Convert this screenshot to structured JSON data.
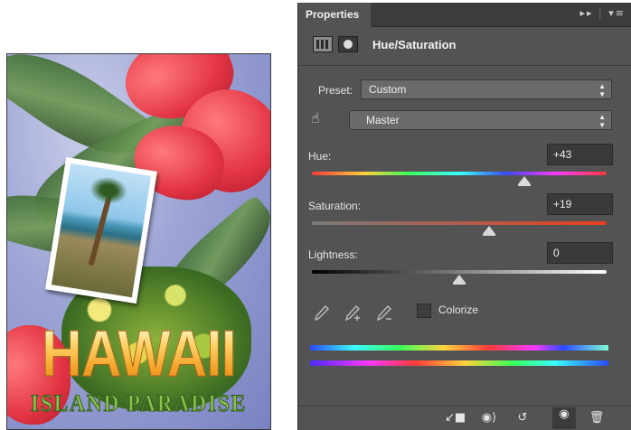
{
  "panel": {
    "tab_label": "Properties",
    "adjustment_title": "Hue/Saturation",
    "preset": {
      "label": "Preset:",
      "value": "Custom"
    },
    "channel": {
      "value": "Master"
    },
    "hue": {
      "label": "Hue:",
      "value": "+43",
      "level_fraction": 0.72
    },
    "saturation": {
      "label": "Saturation:",
      "value": "+19",
      "level_fraction": 0.6
    },
    "lightness": {
      "label": "Lightness:",
      "value": "0",
      "level_fraction": 0.5
    },
    "colorize_label": "Colorize",
    "colorize_checked": false
  },
  "artwork": {
    "title": "HAWAII",
    "subtitle": "ISLAND PARADISE"
  },
  "colors": {
    "panel_bg": "#535353",
    "tab_bar": "#3c3c3c",
    "value_box": "#3a3a3a"
  },
  "icons": {
    "panel_menu": "menu-icon",
    "collapse": "double-arrow-icon",
    "adjustment": "adjustment-layer-icon",
    "mask": "mask-icon",
    "targeted_adjust": "hand-icon",
    "eyedroppers": [
      "eyedropper-icon",
      "eyedropper-plus-icon",
      "eyedropper-minus-icon"
    ],
    "footer": [
      "clip-to-layer-icon",
      "view-previous-icon",
      "reset-icon",
      "visibility-eye-icon",
      "trash-icon"
    ]
  }
}
